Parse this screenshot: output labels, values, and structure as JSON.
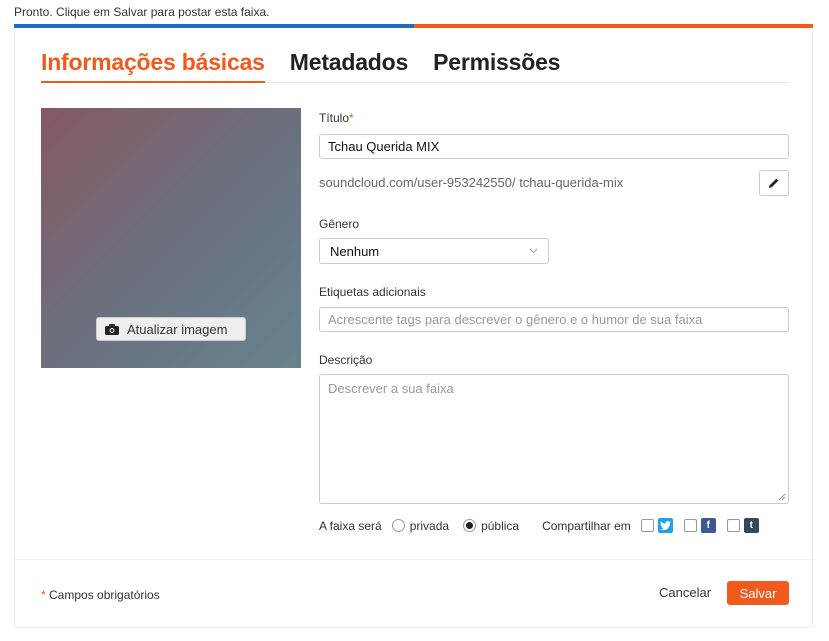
{
  "status": {
    "message": "Pronto. Clique em Salvar para postar esta faixa.",
    "progress_percent": 50
  },
  "tabs": [
    {
      "label": "Informações básicas",
      "active": true
    },
    {
      "label": "Metadados",
      "active": false
    },
    {
      "label": "Permissões",
      "active": false
    }
  ],
  "artwork": {
    "update_label": "Atualizar imagem",
    "icon": "camera-icon"
  },
  "title_field": {
    "label": "Título",
    "required_mark": "*",
    "value": "Tchau Querida MIX"
  },
  "permalink": {
    "text": "soundcloud.com/user-953242550/ tchau-querida-mix",
    "edit_icon": "pencil-icon"
  },
  "genre_field": {
    "label": "Gênero",
    "value": "Nenhum"
  },
  "tags_field": {
    "label": "Etiquetas adicionais",
    "placeholder": "Acrescente tags para descrever o gênero e o humor de sua faixa"
  },
  "description_field": {
    "label": "Descrição",
    "placeholder": "Descrever a sua faixa"
  },
  "privacy": {
    "label": "A faixa será",
    "options": [
      {
        "label": "privada",
        "selected": false
      },
      {
        "label": "pública",
        "selected": true
      }
    ]
  },
  "share": {
    "label": "Compartilhar em",
    "networks": [
      {
        "name": "twitter",
        "glyph": "",
        "color": "#1da1f2",
        "checked": false
      },
      {
        "name": "facebook",
        "glyph": "f",
        "color": "#3b5998",
        "checked": false
      },
      {
        "name": "tumblr",
        "glyph": "t",
        "color": "#36465d",
        "checked": false
      }
    ]
  },
  "footer": {
    "required_star": "*",
    "required_note": "Campos obrigatórios",
    "cancel_label": "Cancelar",
    "save_label": "Salvar"
  },
  "colors": {
    "accent": "#f2591c",
    "progress_done": "#1f6dc2"
  }
}
